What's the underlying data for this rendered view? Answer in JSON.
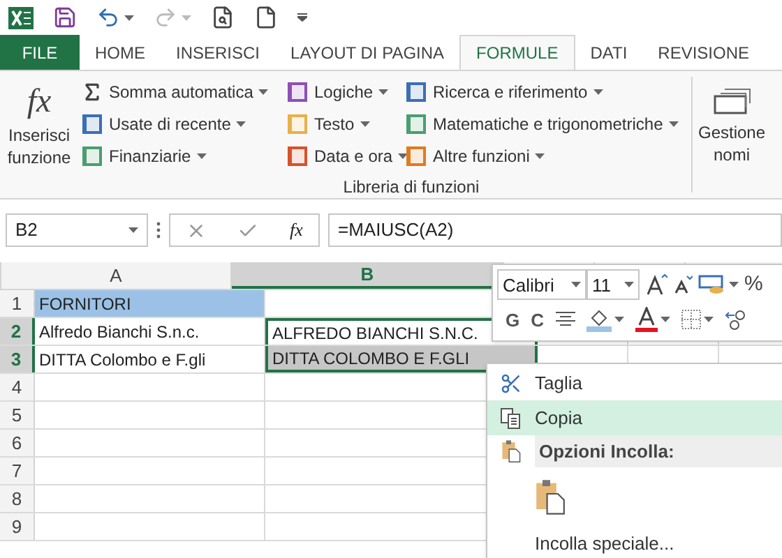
{
  "tabs": [
    {
      "label": "FILE",
      "kind": "file",
      "selected": false
    },
    {
      "label": "HOME",
      "kind": "tab",
      "selected": false
    },
    {
      "label": "INSERISCI",
      "kind": "tab",
      "selected": false
    },
    {
      "label": "LAYOUT DI PAGINA",
      "kind": "tab",
      "selected": false
    },
    {
      "label": "FORMULE",
      "kind": "tab",
      "selected": true
    },
    {
      "label": "DATI",
      "kind": "tab",
      "selected": false
    },
    {
      "label": "REVISIONE",
      "kind": "tab",
      "selected": false
    }
  ],
  "ribbon": {
    "insert_function_icon": "fx",
    "insert_function": "Inserisci funzione",
    "function_columns": [
      [
        {
          "label": "Somma automatica"
        },
        {
          "label": "Usate di recente"
        },
        {
          "label": "Finanziarie"
        }
      ],
      [
        {
          "label": "Logiche"
        },
        {
          "label": "Testo"
        },
        {
          "label": "Data e ora"
        }
      ],
      [
        {
          "label": "Ricerca e riferimento"
        },
        {
          "label": "Matematiche e trigonometriche"
        },
        {
          "label": "Altre funzioni"
        }
      ]
    ],
    "group_label": "Libreria di funzioni",
    "name_manager": "Gestione nomi"
  },
  "formula_bar": {
    "name_box": "B2",
    "function_icon": "fx",
    "formula": "=MAIUSC(A2)"
  },
  "sheet": {
    "columns": [
      {
        "label": "A",
        "selected": false
      },
      {
        "label": "B",
        "selected": true
      }
    ],
    "rows": [
      {
        "label": "1",
        "selected": false,
        "cells": [
          {
            "text": "FORNITORI",
            "filled": true,
            "selected": false
          },
          {
            "filled": false,
            "selected": false
          }
        ]
      },
      {
        "label": "2",
        "selected": true,
        "cells": [
          {
            "text": "Alfredo Bianchi S.n.c.",
            "filled": false,
            "selected": false
          },
          {
            "text": "ALFREDO BIANCHI S.N.C.",
            "filled": false,
            "selected": true,
            "active": true
          }
        ]
      },
      {
        "label": "3",
        "selected": true,
        "cells": [
          {
            "text": "DITTA Colombo e F.gli",
            "filled": false,
            "selected": false
          },
          {
            "text": "DITTA COLOMBO E F.GLI",
            "filled": false,
            "selected": true,
            "active": false
          }
        ]
      },
      {
        "label": "4",
        "selected": false
      },
      {
        "label": "5",
        "selected": false
      },
      {
        "label": "6",
        "selected": false
      },
      {
        "label": "7",
        "selected": false
      },
      {
        "label": "8",
        "selected": false
      },
      {
        "label": "9",
        "selected": false
      }
    ]
  },
  "mini_toolbar": {
    "font": "Calibri",
    "size": "11",
    "percent": "%",
    "bold": "G",
    "italic": "C"
  },
  "context_menu": {
    "items": [
      {
        "kind": "item",
        "label": "Taglia",
        "selected": false
      },
      {
        "kind": "item",
        "label": "Copia",
        "selected": true
      },
      {
        "kind": "header",
        "label": "Opzioni Incolla:"
      },
      {
        "kind": "paste_options"
      },
      {
        "kind": "item",
        "label": "Incolla speciale...",
        "selected": false
      }
    ]
  }
}
